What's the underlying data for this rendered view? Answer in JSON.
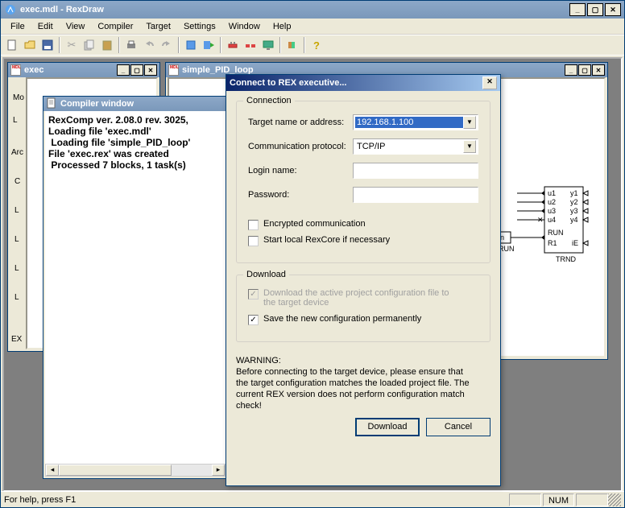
{
  "app": {
    "title": "exec.mdl - RexDraw",
    "menu": [
      "File",
      "Edit",
      "View",
      "Compiler",
      "Target",
      "Settings",
      "Window",
      "Help"
    ]
  },
  "statusbar": {
    "help": "For help, press F1",
    "num": "NUM"
  },
  "exec_window": {
    "title": "exec",
    "side": {
      "mo": "Mo",
      "arc": "Arc",
      "c": "C",
      "l1": "L",
      "l2": "L",
      "l3": "L",
      "l4": "L",
      "ex": "EX"
    }
  },
  "pid_window": {
    "title": "simple_PID_loop"
  },
  "compiler_window": {
    "title": "Compiler window",
    "lines": [
      "RexComp ver. 2.08.0 rev. 3025,",
      "Loading file 'exec.mdl'",
      " Loading file 'simple_PID_loop'",
      "File 'exec.rex' was created",
      " Processed 7 blocks, 1 task(s)"
    ]
  },
  "dialog": {
    "title": "Connect to REX executive...",
    "group_connection": "Connection",
    "lbl_target": "Target name or address:",
    "val_target": "192.168.1.100",
    "lbl_protocol": "Communication protocol:",
    "val_protocol": "TCP/IP",
    "lbl_login": "Login name:",
    "lbl_password": "Password:",
    "chk_encrypted": "Encrypted communication",
    "chk_startlocal": "Start local RexCore if necessary",
    "group_download": "Download",
    "chk_dlactive": "Download the active project configuration file to the target device",
    "chk_saveperm": "Save the new configuration permanently",
    "warning_label": "WARNING:",
    "warning_text": "Before connecting to the target device, please ensure that the target configuration matches the loaded project file. The current REX version does not perform configuration match check!",
    "btn_download": "Download",
    "btn_cancel": "Cancel"
  },
  "diagram": {
    "b_run_on": "on",
    "b_run_lbl": "B_RUN",
    "u1": "u1",
    "u2": "u2",
    "u3": "u3",
    "u4": "u4",
    "run": "RUN",
    "r1": "R1",
    "y1": "y1",
    "y2": "y2",
    "y3": "y3",
    "y4": "y4",
    "ie": "iE",
    "trnd": "TRND"
  }
}
